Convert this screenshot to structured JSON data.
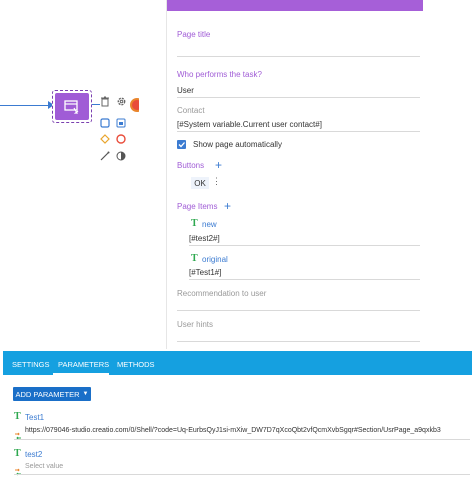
{
  "panel": {
    "page_title_label": "Page title",
    "performer_label": "Who performs the task?",
    "performer_value": "User",
    "contact_label": "Contact",
    "contact_value": "[#System variable.Current user contact#]",
    "show_page_label": "Show page automatically",
    "show_page_checked": true,
    "buttons_label": "Buttons",
    "ok_button": "OK",
    "page_items_label": "Page Items",
    "items": [
      {
        "name": "new",
        "value": "[#test2#]"
      },
      {
        "name": "original",
        "value": "[#Test1#]"
      }
    ],
    "recommendation_label": "Recommendation to user",
    "hints_label": "User hints"
  },
  "bottom": {
    "tabs": [
      "SETTINGS",
      "PARAMETERS",
      "METHODS"
    ],
    "active_tab": "PARAMETERS",
    "add_parameter": "ADD PARAMETER",
    "params": [
      {
        "name": "Test1",
        "value": "https://079046-studio.creatio.com/0/Shell/?code=Uq-EurbsQyJ1si-mXiw_DW7D7qXcoQbt2vfQcmXvbSgqr#Section/UsrPage_a9qxkb3",
        "hint": ""
      },
      {
        "name": "test2",
        "value": "",
        "hint": "Select value"
      }
    ]
  },
  "colors": {
    "accent_purple": "#a05cd6",
    "link_blue": "#3b7bd1",
    "tab_bar": "#15a0e0",
    "add_button": "#1a6fc8"
  },
  "icons": [
    "user-task-icon",
    "trash-icon",
    "gear-icon",
    "square-icon",
    "image-icon",
    "diamond-icon",
    "circle-icon",
    "line-icon",
    "half-circle-icon",
    "text-type-icon",
    "mapping-icon",
    "caret-down-icon"
  ]
}
